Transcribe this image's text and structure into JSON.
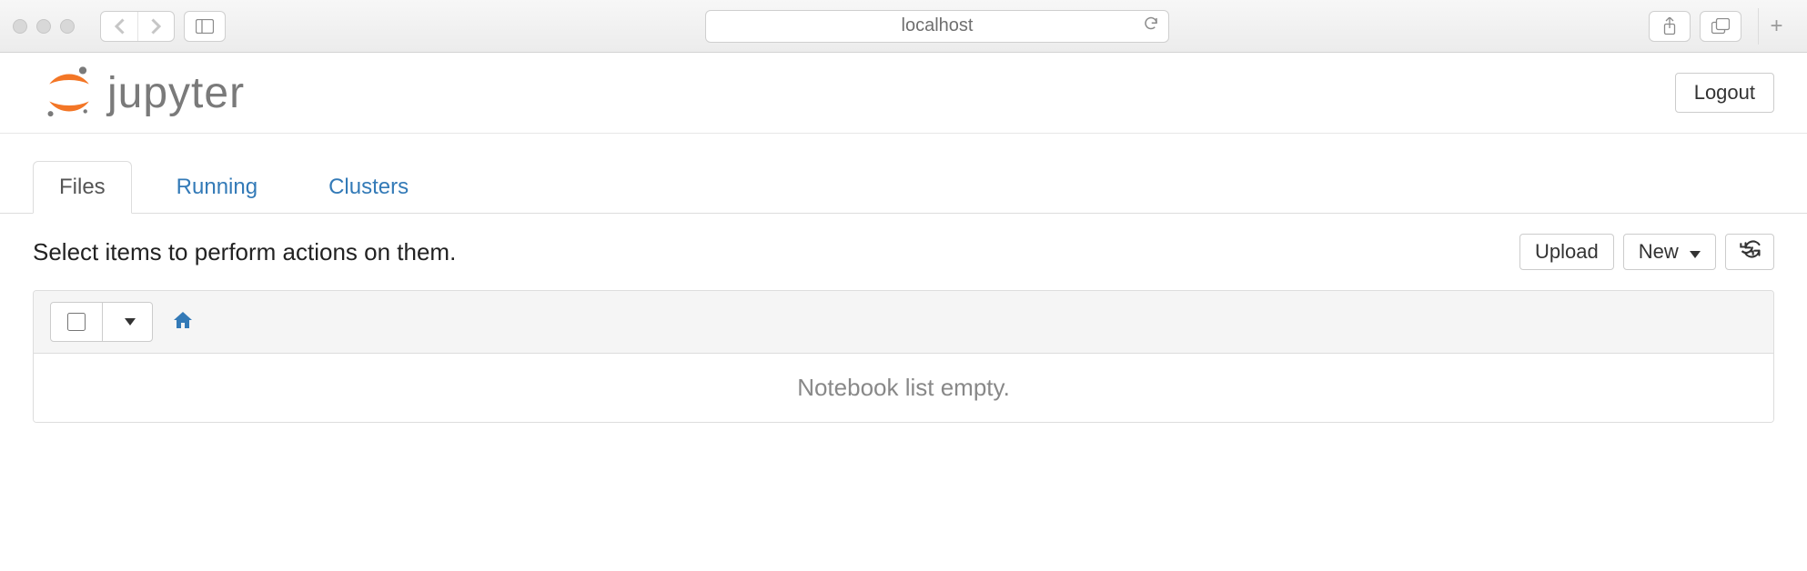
{
  "browser": {
    "address": "localhost"
  },
  "header": {
    "brand": "jupyter",
    "logout_label": "Logout"
  },
  "tabs": [
    {
      "label": "Files",
      "active": true
    },
    {
      "label": "Running",
      "active": false
    },
    {
      "label": "Clusters",
      "active": false
    }
  ],
  "toolbar": {
    "hint": "Select items to perform actions on them.",
    "upload_label": "Upload",
    "new_label": "New"
  },
  "list": {
    "empty_message": "Notebook list empty."
  }
}
